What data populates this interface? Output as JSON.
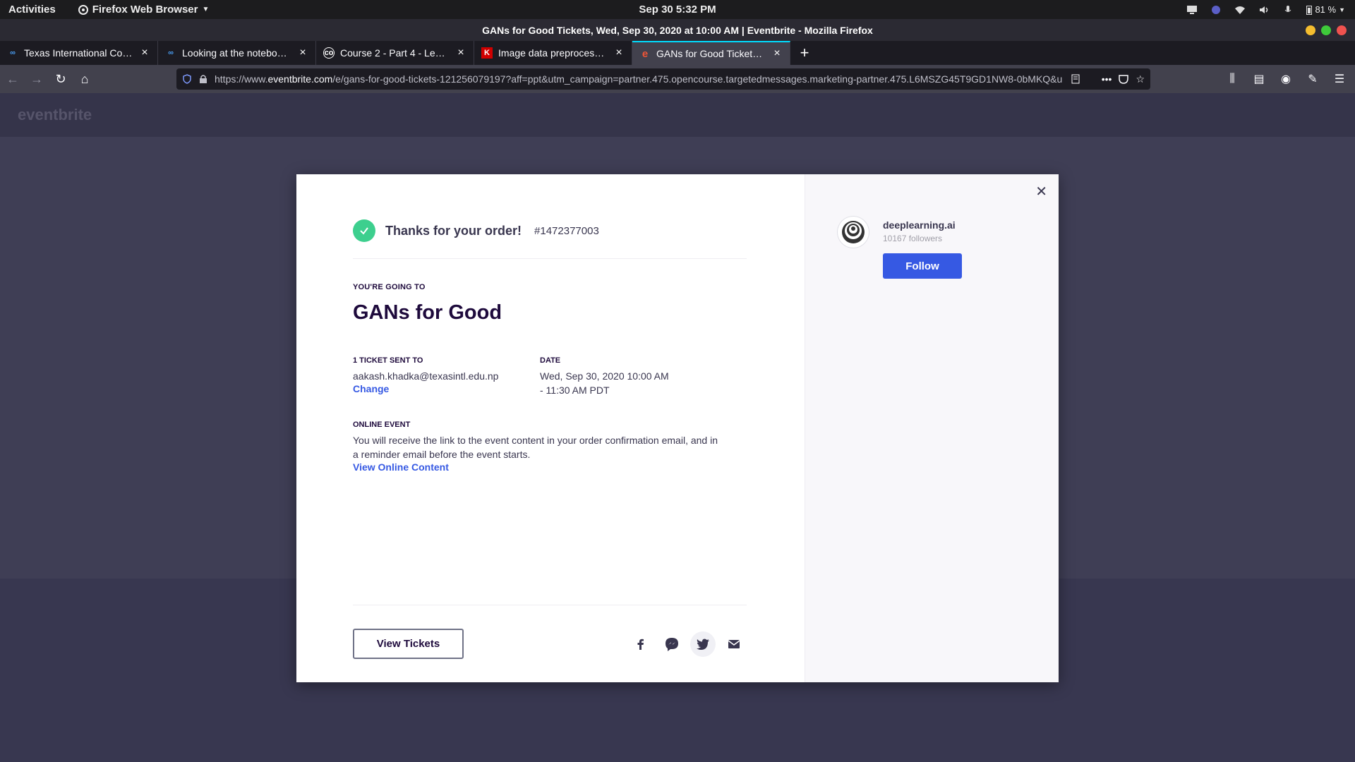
{
  "system": {
    "activities": "Activities",
    "app_menu": "Firefox Web Browser",
    "clock": "Sep 30   5:32 PM",
    "battery": "81 %"
  },
  "window": {
    "title": "GANs for Good Tickets, Wed, Sep 30, 2020 at 10:00 AM | Eventbrite - Mozilla Firefox"
  },
  "tabs": [
    {
      "label": "Texas International College"
    },
    {
      "label": "Looking at the notebook | Coursera"
    },
    {
      "label": "Course 2 - Part 4 - Lesson 2"
    },
    {
      "label": "Image data preprocessing"
    },
    {
      "label": "GANs for Good Tickets, Wed"
    }
  ],
  "url": {
    "prefix": "https://www.",
    "domain": "eventbrite.com",
    "rest": "/e/gans-for-good-tickets-121256079197?aff=ppt&utm_campaign=partner.475.opencourse.targetedmessages.marketing-partner.475.L6MSZG45T9GD1NW8-0bMKQ&u"
  },
  "modal": {
    "thanks": "Thanks for your order!",
    "order_number": "#1472377003",
    "going_label": "YOU'RE GOING TO",
    "event_title": "GANs for Good",
    "ticket_label": "1 TICKET SENT TO",
    "email": "aakash.khadka@texasintl.edu.np",
    "change": "Change",
    "date_label": "DATE",
    "date_line1": "Wed, Sep 30, 2020 10:00 AM",
    "date_line2": "- 11:30 AM PDT",
    "online_label": "ONLINE EVENT",
    "online_text": "You will receive the link to the event content in your order confirmation email, and in a reminder email before the event starts.",
    "online_link": "View Online Content",
    "view_tickets": "View Tickets"
  },
  "organizer": {
    "name": "deeplearning.ai",
    "followers": "10167 followers",
    "follow": "Follow"
  },
  "colors": {
    "accent": "#3659e3",
    "success": "#3dcf8e",
    "tab_highlight": "#00ddff"
  }
}
